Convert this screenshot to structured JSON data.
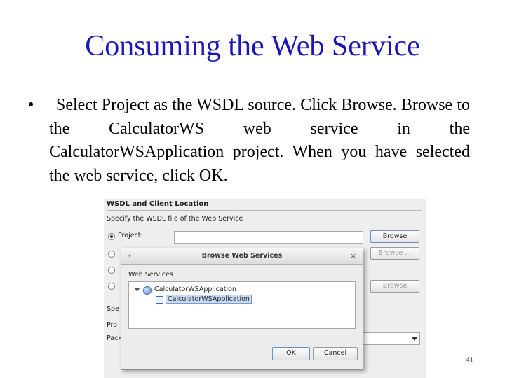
{
  "slide": {
    "title": "Consuming the Web Service",
    "bullet_marker": "•",
    "bullet_first": "Select Project as the WSDL source. Click Browse.",
    "bullet_rest": "Browse to the CalculatorWS web service in the CalculatorWSApplication project. When you have selected the web service, click OK.",
    "page_number": "41"
  },
  "wizard": {
    "section_title": "WSDL and Client Location",
    "instruction": "Specify the WSDL file of the Web Service",
    "project_radio": {
      "label": "Project:",
      "selected": true
    },
    "browse_labels": [
      "Browse",
      "Browse ...",
      "Browse"
    ],
    "partial_labels": [
      "Spe",
      "Pro",
      "Pack"
    ]
  },
  "dialog": {
    "title": "Browse Web Services",
    "section_label": "Web Services",
    "tree": {
      "parent": "CalculatorWSApplication",
      "child": "CalculatorWSApplication"
    },
    "ok_label": "OK",
    "cancel_label": "Cancel"
  }
}
